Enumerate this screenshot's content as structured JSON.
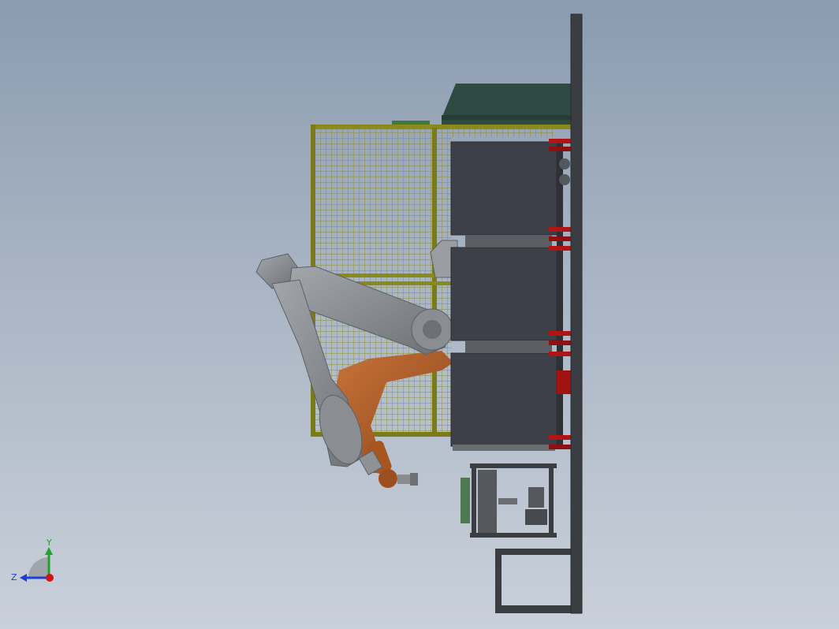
{
  "viewport": {
    "background_top": "#8b9bb0",
    "background_bottom": "#c9d0da"
  },
  "triad": {
    "y_label": "Y",
    "z_label": "Z",
    "y_color": "#1fa32a",
    "z_color": "#1d3fd6",
    "x_color": "#d01515"
  },
  "colors": {
    "fence": "#8a8a1c",
    "enclosure": "#3d4048",
    "roof": "#2e4a42",
    "robot_gray": "#8e9296",
    "robot_orange": "#b2612a",
    "wall": "#3a3d42",
    "clamp_red": "#b01414"
  }
}
